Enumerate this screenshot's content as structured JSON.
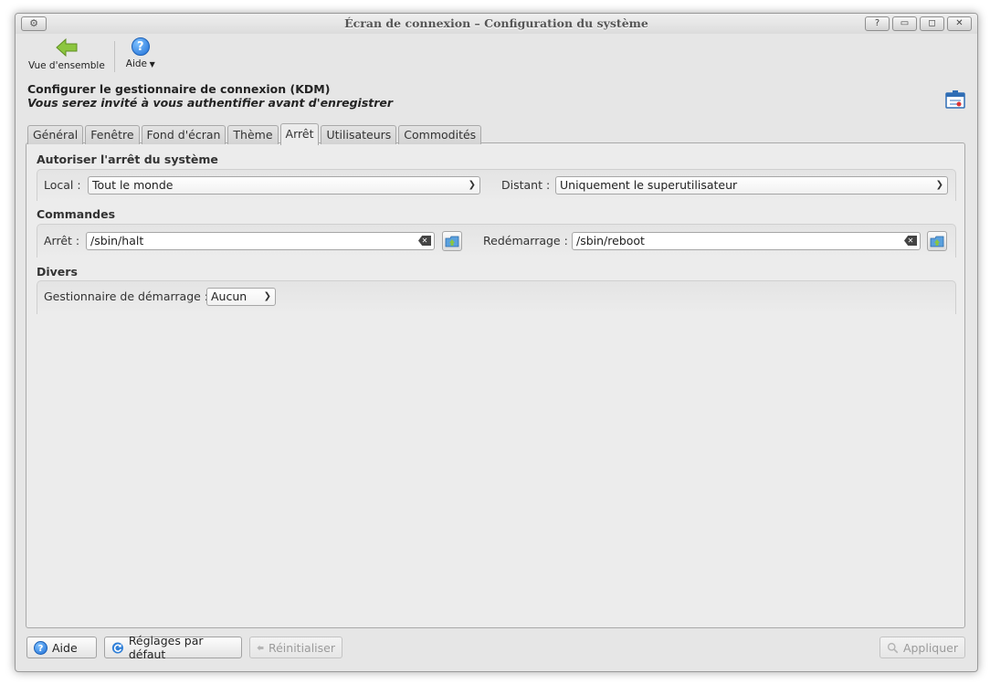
{
  "window": {
    "title": "Écran de connexion – Configuration du système"
  },
  "toolbar": {
    "overview_label": "Vue d'ensemble",
    "help_label": "Aide"
  },
  "header": {
    "title": "Configurer le gestionnaire de connexion (KDM)",
    "subtitle": "Vous serez invité à vous authentifier avant d'enregistrer"
  },
  "tabs": [
    {
      "label": "Général"
    },
    {
      "label": "Fenêtre"
    },
    {
      "label": "Fond d'écran"
    },
    {
      "label": "Thème"
    },
    {
      "label": "Arrêt",
      "active": true
    },
    {
      "label": "Utilisateurs"
    },
    {
      "label": "Commodités"
    }
  ],
  "shutdown": {
    "title": "Autoriser l'arrêt du système",
    "local_label": "Local :",
    "local_value": "Tout le monde",
    "remote_label": "Distant :",
    "remote_value": "Uniquement le superutilisateur"
  },
  "commands": {
    "title": "Commandes",
    "halt_label": "Arrêt :",
    "halt_value": "/sbin/halt",
    "reboot_label": "Redémarrage :",
    "reboot_value": "/sbin/reboot"
  },
  "misc": {
    "title": "Divers",
    "bootmanager_label": "Gestionnaire de démarrage :",
    "bootmanager_value": "Aucun"
  },
  "buttons": {
    "help": "Aide",
    "defaults": "Réglages par défaut",
    "reset": "Réinitialiser",
    "apply": "Appliquer"
  },
  "colors": {
    "accent_blue": "#1f6fd6",
    "back_arrow_green": "#8cc63f"
  }
}
